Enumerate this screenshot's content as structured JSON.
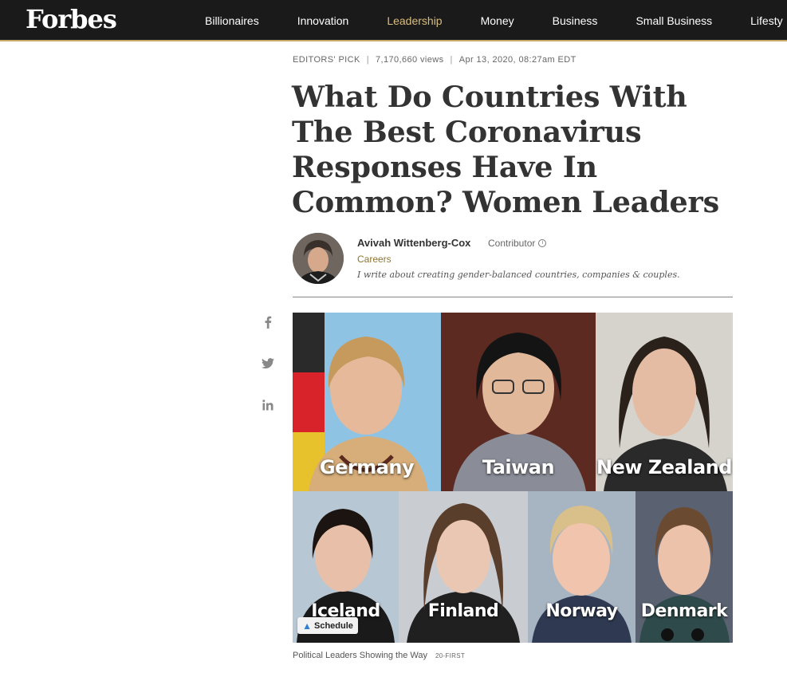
{
  "header": {
    "logo": "Forbes",
    "nav": [
      "Billionaires",
      "Innovation",
      "Leadership",
      "Money",
      "Business",
      "Small Business",
      "Lifesty"
    ]
  },
  "article": {
    "label": "EDITORS' PICK",
    "views": "7,170,660 views",
    "date": "Apr 13, 2020, 08:27am EDT",
    "title": "What Do Countries With The Best Coronavirus Responses Have In Common? Women Leaders"
  },
  "author": {
    "name": "Avivah Wittenberg-Cox",
    "role": "Contributor",
    "section": "Careers",
    "bio": "I write about creating gender-balanced countries, companies & couples."
  },
  "share_icons": [
    "facebook-icon",
    "twitter-icon",
    "linkedin-icon"
  ],
  "image": {
    "countries": [
      "Germany",
      "Taiwan",
      "New Zealand",
      "Iceland",
      "Finland",
      "Norway",
      "Denmark"
    ],
    "badge": "Schedule"
  },
  "caption": {
    "text": "Political Leaders Showing the Way",
    "credit": "20-FIRST"
  },
  "colors": {
    "nav_bg": "#1a1a1a",
    "accent_gold": "#d9bd7f",
    "section_link": "#8f7433"
  }
}
